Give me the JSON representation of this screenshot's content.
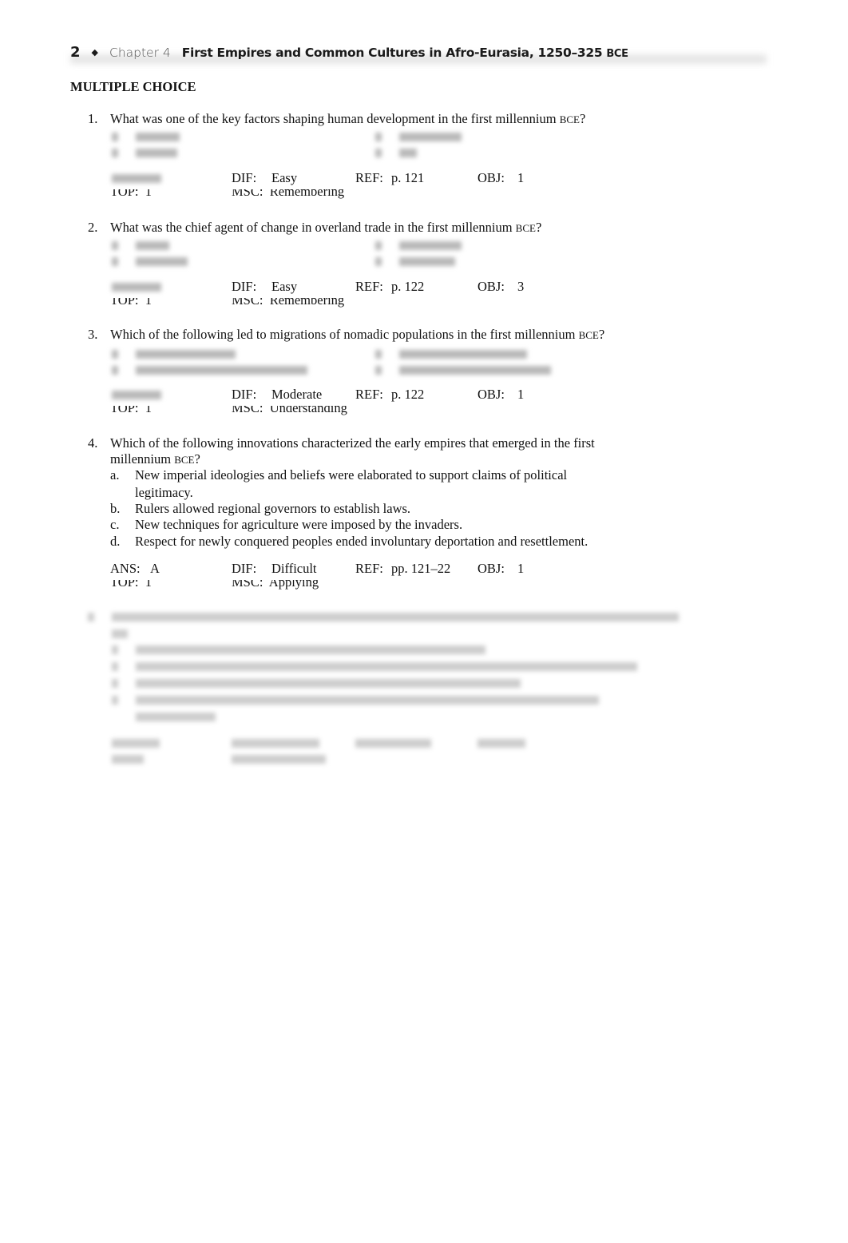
{
  "header": {
    "page_number": "2",
    "bullet": "◆",
    "chapter": "Chapter 4",
    "title": "First Empires and Common Cultures in Afro-Eurasia, 1250–325",
    "era": "BCE"
  },
  "section_title": "MULTIPLE CHOICE",
  "questions": [
    {
      "number": "1.",
      "text": "What was one of the key factors shaping human development in the first millennium",
      "era": "BCE",
      "end": "?",
      "meta": {
        "dif_label": "DIF:",
        "dif": "Easy",
        "ref_label": "REF:",
        "ref": "p.  121",
        "obj_label": "OBJ:",
        "obj": "1",
        "top_label": "TOP:",
        "top": "1",
        "msc_label": "MSC:",
        "msc": "Remembering"
      }
    },
    {
      "number": "2.",
      "text": "What was the chief agent of change in overland trade in the first millennium",
      "era": "BCE",
      "end": "?",
      "meta": {
        "dif_label": "DIF:",
        "dif": "Easy",
        "ref_label": "REF:",
        "ref": "p.  122",
        "obj_label": "OBJ:",
        "obj": "3",
        "top_label": "TOP:",
        "top": "1",
        "msc_label": "MSC:",
        "msc": "Remembering"
      }
    },
    {
      "number": "3.",
      "text": "Which of the following led to migrations of nomadic populations in the first millennium",
      "era": "BCE",
      "end": "?",
      "meta": {
        "dif_label": "DIF:",
        "dif": "Moderate",
        "ref_label": "REF:",
        "ref": "p.  122",
        "obj_label": "OBJ:",
        "obj": "1",
        "top_label": "TOP:",
        "top": "1",
        "msc_label": "MSC:",
        "msc": "Understanding"
      }
    },
    {
      "number": "4.",
      "text_line1": "Which of the following innovations characterized the early empires that emerged in the first",
      "text_line2": "millennium",
      "era": "BCE",
      "end": "?",
      "options": [
        {
          "letter": "a.",
          "line1": "New imperial ideologies and beliefs were elaborated to support claims of political",
          "line2": "legitimacy."
        },
        {
          "letter": "b.",
          "line1": "Rulers allowed regional governors to establish laws."
        },
        {
          "letter": "c.",
          "line1": "New techniques for agriculture were imposed by the invaders."
        },
        {
          "letter": "d.",
          "line1": "Respect for newly conquered peoples ended involuntary deportation and resettlement."
        }
      ],
      "meta": {
        "ans_label": "ANS:",
        "ans": "A",
        "dif_label": "DIF:",
        "dif": "Difficult",
        "ref_label": "REF:",
        "ref": "pp.  121–22",
        "obj_label": "OBJ:",
        "obj": "1",
        "top_label": "TOP:",
        "top": "1",
        "msc_label": "MSC:",
        "msc": "Applying"
      }
    }
  ]
}
